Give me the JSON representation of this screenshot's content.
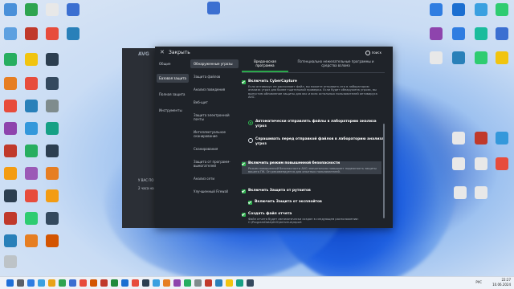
{
  "desktop_left": [
    {
      "label": "",
      "color": "#4a90d9"
    },
    {
      "label": "",
      "color": "#2ea44f"
    },
    {
      "label": "",
      "color": "#e8e8e8"
    },
    {
      "label": "",
      "color": "#3b6fd1"
    },
    {
      "label": "",
      "color": "#5da0e0"
    },
    {
      "label": "",
      "color": "#c0392b"
    },
    {
      "label": "",
      "color": "#e74c3c"
    },
    {
      "label": "",
      "color": "#2980b9"
    },
    {
      "label": "",
      "color": "#27ae60"
    },
    {
      "label": "",
      "color": "#f1c40f"
    },
    {
      "label": "",
      "color": "#2c3e50"
    },
    {
      "label": "",
      "color": "#e67e22"
    },
    {
      "label": "",
      "color": "#e74c3c"
    },
    {
      "label": "",
      "color": "#34495e"
    },
    {
      "label": "",
      "color": "#e74c3c"
    },
    {
      "label": "",
      "color": "#2980b9"
    },
    {
      "label": "",
      "color": "#7f8c8d"
    },
    {
      "label": "",
      "color": "#8e44ad"
    },
    {
      "label": "",
      "color": "#3498db"
    },
    {
      "label": "",
      "color": "#16a085"
    },
    {
      "label": "",
      "color": "#c0392b"
    },
    {
      "label": "",
      "color": "#27ae60"
    },
    {
      "label": "",
      "color": "#2c3e50"
    },
    {
      "label": "",
      "color": "#f39c12"
    },
    {
      "label": "",
      "color": "#9b59b6"
    },
    {
      "label": "",
      "color": "#e67e22"
    },
    {
      "label": "",
      "color": "#2c3e50"
    },
    {
      "label": "",
      "color": "#e74c3c"
    },
    {
      "label": "",
      "color": "#f39c12"
    },
    {
      "label": "",
      "color": "#c0392b"
    },
    {
      "label": "",
      "color": "#2ecc71"
    },
    {
      "label": "",
      "color": "#34495e"
    },
    {
      "label": "",
      "color": "#2980b9"
    },
    {
      "label": "",
      "color": "#e67e22"
    },
    {
      "label": "",
      "color": "#d35400"
    },
    {
      "label": "",
      "color": "#bdc3c7"
    }
  ],
  "desktop_right": [
    {
      "label": "",
      "color": "#2f7de1"
    },
    {
      "label": "",
      "color": "#1b6fd1"
    },
    {
      "label": "",
      "color": "#3aa0e0"
    },
    {
      "label": "",
      "color": "#2ecc71"
    },
    {
      "label": "",
      "color": "#8e44ad"
    },
    {
      "label": "",
      "color": "#2f7de1"
    },
    {
      "label": "",
      "color": "#1abc9c"
    },
    {
      "label": "",
      "color": "#3b6fd1"
    },
    {
      "label": "",
      "color": "#e8e8e8"
    },
    {
      "label": "",
      "color": "#2980b9"
    },
    {
      "label": "",
      "color": "#2ecc71"
    },
    {
      "label": "",
      "color": "#f1c40f"
    },
    {
      "label": "",
      "color": "#e8e8e8"
    },
    {
      "label": "",
      "color": "#c0392b"
    },
    {
      "label": "",
      "color": "#3498db"
    },
    {
      "label": "",
      "color": "#e8e8e8"
    },
    {
      "label": "",
      "color": "#e8e8e8"
    },
    {
      "label": "",
      "color": "#e74c3c"
    },
    {
      "label": "",
      "color": "#e8e8e8"
    },
    {
      "label": "",
      "color": "#e8e8e8"
    }
  ],
  "desktop_top": {
    "label": "",
    "color": "#3b6fd1"
  },
  "avg_main": {
    "logo": "AVG",
    "lines": [
      "У ВАС ПО",
      "2 часа на"
    ]
  },
  "dialog": {
    "close_label": "Закрыть",
    "search_label": "поиск",
    "nav_primary": [
      {
        "label": "Общие",
        "active": false
      },
      {
        "label": "Базовая защита",
        "active": true
      },
      {
        "label": "Полная защита",
        "active": false
      },
      {
        "label": "Инструменты",
        "active": false
      }
    ],
    "nav_secondary": [
      {
        "label": "Обнаруженные угрозы",
        "active": true
      },
      {
        "label": "Защита файлов",
        "active": false
      },
      {
        "label": "Анализ поведения",
        "active": false
      },
      {
        "label": "Веб-щит",
        "active": false
      },
      {
        "label": "Защита электронной почты",
        "active": false
      },
      {
        "label": "Интеллектуальное сканирование",
        "active": false
      },
      {
        "label": "Сканирования",
        "active": false
      },
      {
        "label": "Защита от программ-вымогателей",
        "active": false
      },
      {
        "label": "Анализ сети",
        "active": false
      },
      {
        "label": "Улучшенный Firewall",
        "active": false
      }
    ],
    "tabs": [
      {
        "label": "Вредоносная программа",
        "active": true
      },
      {
        "label": "Потенциально нежелательные программы и средства взлома",
        "active": false
      }
    ],
    "options": [
      {
        "type": "checkbox",
        "checked": true,
        "label": "Включить CyberCapture",
        "desc": "Если антивирус не распознает файл, вы можете отправить его в лабораторию анализа угроз для более тщательной проверки. Если будет обнаружена угроза, вы выпустим обновление защиты для вас и всех остальных пользователей антивируса AVG."
      },
      {
        "type": "radio",
        "checked": true,
        "label": "Автоматически отправлять файлы в лабораторию анализа угроз",
        "desc": ""
      },
      {
        "type": "radio",
        "checked": false,
        "label": "Спрашивать перед отправкой файлов в лабораторию анализа угроз",
        "desc": ""
      },
      {
        "type": "checkbox",
        "checked": true,
        "label": "Включить режим повышенной безопасности",
        "desc": "Режим повышенной безопасности AVG значительно повышает надежность защиты вашего ПК. Он рекомендуется для опытных пользователей."
      },
      {
        "type": "checkbox",
        "checked": true,
        "label": "Включить Защита от руткитов",
        "desc": ""
      },
      {
        "type": "checkbox",
        "checked": true,
        "label": "Включить Защита от эксплойтов",
        "desc": ""
      },
      {
        "type": "checkbox",
        "checked": true,
        "label": "Создать файл отчета",
        "desc": "Файл отчета будет автоматически создан в следующем расположении: C:\\ProgramData\\AVG\\Antivirus\\report"
      }
    ]
  },
  "taskbar": {
    "icons": [
      "#1e6fd8",
      "#5a5f68",
      "#2f7de1",
      "#3aa0e0",
      "#e8a317",
      "#2ea44f",
      "#3b6fd1",
      "#e74c3c",
      "#d35400",
      "#c0392b",
      "#1f8a3b",
      "#1b6fd1",
      "#e74c3c",
      "#2c3e50",
      "#3aa0e0",
      "#e67e22",
      "#8e44ad",
      "#27ae60",
      "#7f8c8d",
      "#c0392b",
      "#2980b9",
      "#f1c40f",
      "#16a085",
      "#34495e"
    ],
    "lang": "РУС",
    "time": "22:27",
    "date": "10.06.2024"
  }
}
